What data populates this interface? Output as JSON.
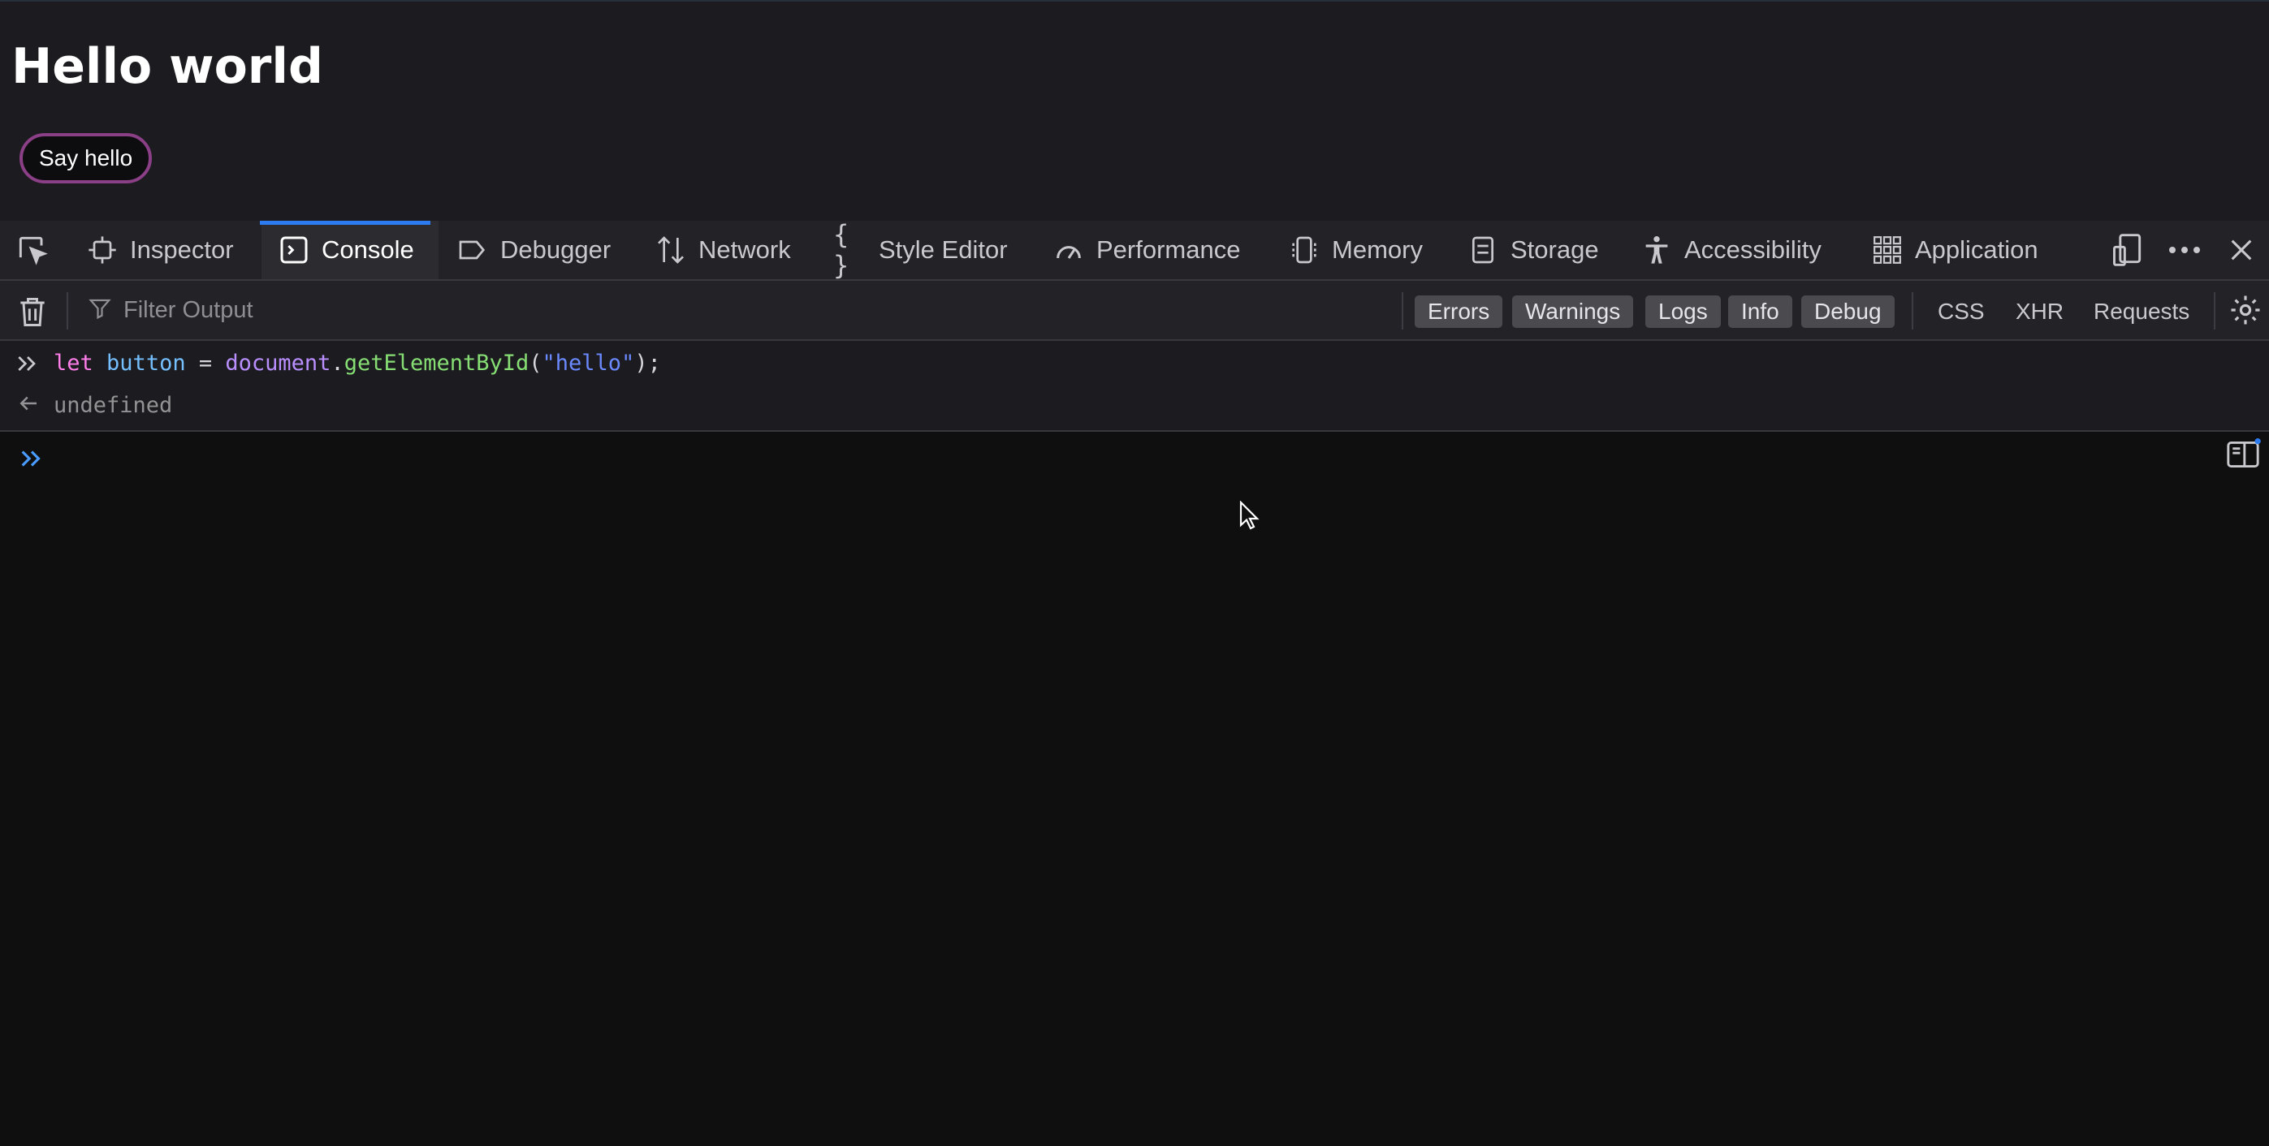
{
  "page": {
    "heading": "Hello world",
    "button_label": "Say hello"
  },
  "devtools": {
    "tabs": [
      {
        "label": "Inspector",
        "icon": "inspector-icon"
      },
      {
        "label": "Console",
        "icon": "console-icon",
        "selected": true
      },
      {
        "label": "Debugger",
        "icon": "debugger-icon"
      },
      {
        "label": "Network",
        "icon": "network-icon"
      },
      {
        "label": "Style Editor",
        "icon": "style-editor-icon"
      },
      {
        "label": "Performance",
        "icon": "performance-icon"
      },
      {
        "label": "Memory",
        "icon": "memory-icon"
      },
      {
        "label": "Storage",
        "icon": "storage-icon"
      },
      {
        "label": "Accessibility",
        "icon": "accessibility-icon"
      },
      {
        "label": "Application",
        "icon": "application-icon"
      }
    ],
    "right_icons": [
      "responsive-design-icon",
      "more-options-icon",
      "close-icon"
    ],
    "accent_color": "#2d7bf0"
  },
  "filterbar": {
    "placeholder": "Filter Output",
    "levels": [
      "Errors",
      "Warnings",
      "Logs",
      "Info",
      "Debug"
    ],
    "extra": [
      "CSS",
      "XHR",
      "Requests"
    ]
  },
  "console": {
    "input_tokens": {
      "kw": "let",
      "var": "button",
      "eq": " = ",
      "obj": "document",
      "dot": ".",
      "fn": "getElementById",
      "open": "(",
      "str": "\"hello\"",
      "close": ");"
    },
    "result": "undefined"
  }
}
